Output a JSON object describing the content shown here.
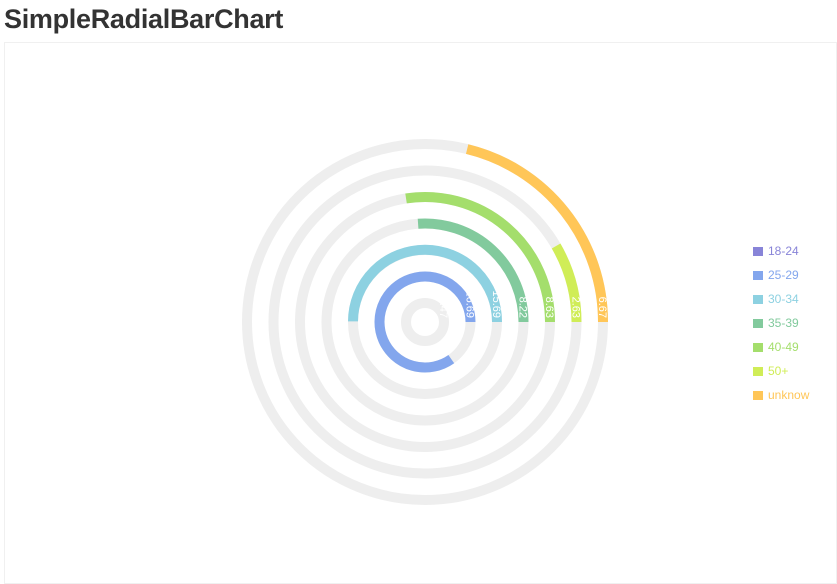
{
  "page": {
    "title": "SimpleRadialBarChart"
  },
  "chart_data": {
    "type": "radial-bar",
    "title": "SimpleRadialBarChart",
    "background_track": true,
    "legend_position": "right-middle",
    "series": [
      {
        "name": "18-24",
        "value": 31.47,
        "color": "#8884d8"
      },
      {
        "name": "25-29",
        "value": 26.69,
        "color": "#83a6ed"
      },
      {
        "name": "30-34",
        "value": 15.69,
        "color": "#8dd1e1"
      },
      {
        "name": "35-39",
        "value": 8.22,
        "color": "#82ca9d"
      },
      {
        "name": "40-49",
        "value": 8.63,
        "color": "#a4de6c"
      },
      {
        "name": "50+",
        "value": 2.63,
        "color": "#d0ed57"
      },
      {
        "name": "unknow",
        "value": 6.67,
        "color": "#ffc658"
      }
    ],
    "track_color": "#eeeeee"
  }
}
